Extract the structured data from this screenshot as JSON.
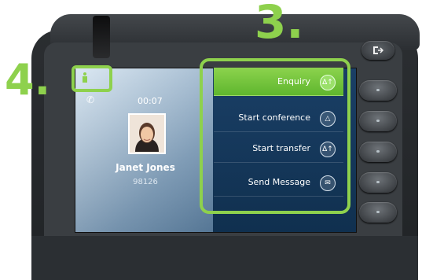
{
  "callouts": {
    "three": "3.",
    "four": "4."
  },
  "call": {
    "timer": "00:07",
    "contact_name": "Janet Jones",
    "contact_number": "98126"
  },
  "menu": {
    "items": [
      {
        "label": "Enquiry",
        "icon": "enquiry-icon",
        "active": true
      },
      {
        "label": "Start conference",
        "icon": "conference-icon",
        "active": false
      },
      {
        "label": "Start transfer",
        "icon": "transfer-icon",
        "active": false
      },
      {
        "label": "Send Message",
        "icon": "message-icon",
        "active": false
      }
    ]
  },
  "colors": {
    "callout_green": "#8ed14d",
    "selected_item": "#6cc03a",
    "screen_blue": "#10304f"
  }
}
